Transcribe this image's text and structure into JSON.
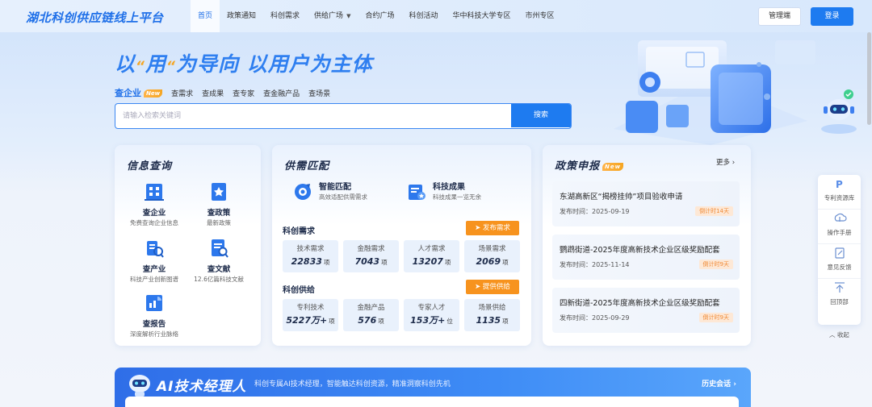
{
  "nav": {
    "logo": "湖北科创供应链线上平台",
    "items": [
      {
        "label": "首页",
        "active": true
      },
      {
        "label": "政策通知"
      },
      {
        "label": "科创需求"
      },
      {
        "label": "供给广场",
        "dropdown": true
      },
      {
        "label": "合约广场"
      },
      {
        "label": "科创活动"
      },
      {
        "label": "华中科技大学专区"
      },
      {
        "label": "市州专区"
      }
    ],
    "admin": "管理端",
    "login": "登录"
  },
  "hero": {
    "slogan_a": "以",
    "slogan_q1": "“",
    "slogan_b": "用",
    "slogan_q2": "“",
    "slogan_c": "为导向 以用户为主体",
    "tabs": [
      "查企业",
      "查需求",
      "查成果",
      "查专家",
      "查金融产品",
      "查场景"
    ],
    "new_tag": "New",
    "search_placeholder": "请输入检索关键词",
    "search_button": "搜索"
  },
  "info": {
    "title": "信息查询",
    "items": [
      {
        "name": "查企业",
        "desc": "免费查询企业信息",
        "icon": "enterprise-icon"
      },
      {
        "name": "查政策",
        "desc": "最新政策",
        "icon": "policy-icon"
      },
      {
        "name": "查产业",
        "desc": "科技产业创新图谱",
        "icon": "industry-icon"
      },
      {
        "name": "查文献",
        "desc": "12.6亿篇科技文献",
        "icon": "literature-icon"
      },
      {
        "name": "查报告",
        "desc": "深度解析行业脉络",
        "icon": "report-icon"
      }
    ]
  },
  "match": {
    "title": "供需匹配",
    "features": [
      {
        "name": "智能匹配",
        "desc": "高效适配供需需求",
        "icon": "smart-match-icon"
      },
      {
        "name": "科技成果",
        "desc": "科技成果一览无余",
        "icon": "tech-achievement-icon"
      }
    ],
    "demand": {
      "title": "科创需求",
      "button": "发布需求",
      "stats": [
        {
          "label": "技术需求",
          "value": "22833",
          "unit": "项"
        },
        {
          "label": "金融需求",
          "value": "7043",
          "unit": "项"
        },
        {
          "label": "人才需求",
          "value": "13207",
          "unit": "项"
        },
        {
          "label": "场景需求",
          "value": "2069",
          "unit": "项"
        }
      ]
    },
    "supply": {
      "title": "科创供给",
      "button": "提供供给",
      "stats": [
        {
          "label": "专利技术",
          "value": "5227万+",
          "unit": "项"
        },
        {
          "label": "金融产品",
          "value": "576",
          "unit": "项"
        },
        {
          "label": "专家人才",
          "value": "153万+",
          "unit": "位"
        },
        {
          "label": "场景供给",
          "value": "1135",
          "unit": "项"
        }
      ]
    }
  },
  "policy": {
    "title": "政策申报",
    "new_tag": "New",
    "more": "更多",
    "items": [
      {
        "title": "东湖高新区“揭榜挂帅”项目验收申请",
        "date_label": "发布时间：",
        "date": "2025-09-19",
        "badge": "倒计时14天"
      },
      {
        "title": "鹦鹉街道-2025年度高新技术企业区级奖励配套",
        "date_label": "发布时间：",
        "date": "2025-11-14",
        "badge": "倒计时9天"
      },
      {
        "title": "四新街道-2025年度高新技术企业区级奖励配套",
        "date_label": "发布时间：",
        "date": "2025-09-29",
        "badge": "倒计时9天"
      }
    ]
  },
  "ai": {
    "title": "AI技术经理人",
    "desc": "科创专属AI技术经理，智能触达科创资源，精准洞察科创先机",
    "history": "历史会话",
    "history_arrow": "›"
  },
  "side_tools": [
    {
      "label": "专利资源库",
      "icon": "patent-icon"
    },
    {
      "label": "操作手册",
      "icon": "manual-icon"
    },
    {
      "label": "意见反馈",
      "icon": "feedback-icon"
    },
    {
      "label": "回顶部",
      "icon": "back-to-top-icon"
    }
  ],
  "side_collapse": "收起",
  "colors": {
    "primary": "#1e7bf0",
    "orange": "#f7931e",
    "title": "#1d2b4a"
  }
}
